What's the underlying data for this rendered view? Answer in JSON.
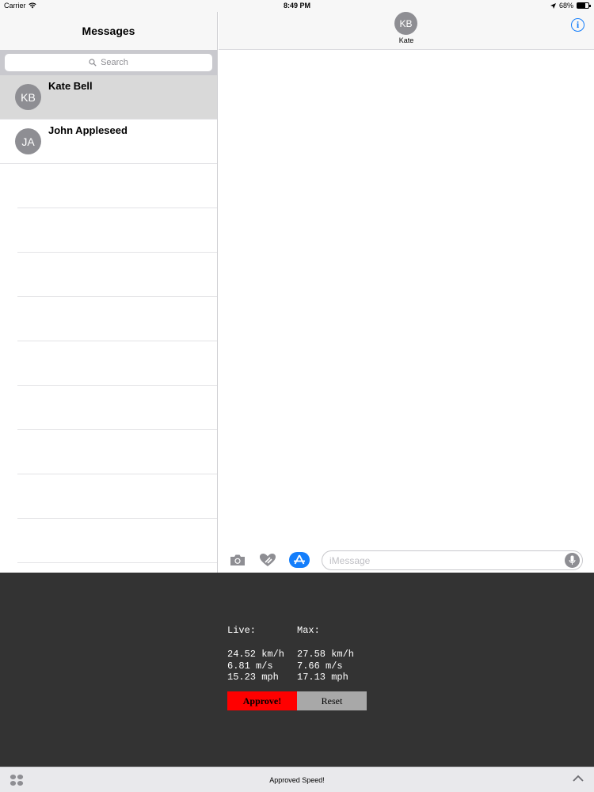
{
  "status_bar": {
    "carrier": "Carrier",
    "time": "8:49 PM",
    "battery_percent": "68%",
    "battery_level": 0.68
  },
  "sidebar": {
    "title": "Messages",
    "search_placeholder": "Search",
    "conversations": [
      {
        "initials": "KB",
        "name": "Kate Bell",
        "selected": true
      },
      {
        "initials": "JA",
        "name": "John Appleseed",
        "selected": false
      }
    ]
  },
  "chat": {
    "contact_initials": "KB",
    "contact_name": "Kate",
    "input_placeholder": "iMessage"
  },
  "extension": {
    "live_label": "Live:",
    "max_label": "Max:",
    "live_values": [
      "24.52 km/h",
      "6.81 m/s",
      "15.23 mph"
    ],
    "max_values": [
      "27.58 km/h",
      "7.66 m/s",
      "17.13 mph"
    ],
    "approve_label": "Approve!",
    "reset_label": "Reset",
    "approve_color": "#ff0000"
  },
  "bottom_bar": {
    "title": "Approved Speed!"
  },
  "colors": {
    "accent": "#147efb",
    "panel_bg": "#333333"
  }
}
